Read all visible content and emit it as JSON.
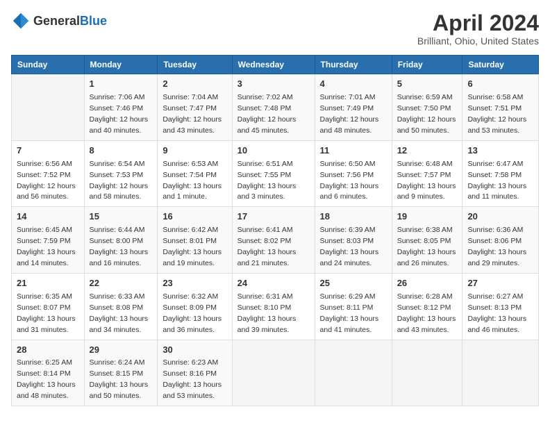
{
  "header": {
    "logo_general": "General",
    "logo_blue": "Blue",
    "title": "April 2024",
    "subtitle": "Brilliant, Ohio, United States"
  },
  "days_of_week": [
    "Sunday",
    "Monday",
    "Tuesday",
    "Wednesday",
    "Thursday",
    "Friday",
    "Saturday"
  ],
  "weeks": [
    [
      {
        "day": "",
        "sunrise": "",
        "sunset": "",
        "daylight": ""
      },
      {
        "day": "1",
        "sunrise": "Sunrise: 7:06 AM",
        "sunset": "Sunset: 7:46 PM",
        "daylight": "Daylight: 12 hours and 40 minutes."
      },
      {
        "day": "2",
        "sunrise": "Sunrise: 7:04 AM",
        "sunset": "Sunset: 7:47 PM",
        "daylight": "Daylight: 12 hours and 43 minutes."
      },
      {
        "day": "3",
        "sunrise": "Sunrise: 7:02 AM",
        "sunset": "Sunset: 7:48 PM",
        "daylight": "Daylight: 12 hours and 45 minutes."
      },
      {
        "day": "4",
        "sunrise": "Sunrise: 7:01 AM",
        "sunset": "Sunset: 7:49 PM",
        "daylight": "Daylight: 12 hours and 48 minutes."
      },
      {
        "day": "5",
        "sunrise": "Sunrise: 6:59 AM",
        "sunset": "Sunset: 7:50 PM",
        "daylight": "Daylight: 12 hours and 50 minutes."
      },
      {
        "day": "6",
        "sunrise": "Sunrise: 6:58 AM",
        "sunset": "Sunset: 7:51 PM",
        "daylight": "Daylight: 12 hours and 53 minutes."
      }
    ],
    [
      {
        "day": "7",
        "sunrise": "Sunrise: 6:56 AM",
        "sunset": "Sunset: 7:52 PM",
        "daylight": "Daylight: 12 hours and 56 minutes."
      },
      {
        "day": "8",
        "sunrise": "Sunrise: 6:54 AM",
        "sunset": "Sunset: 7:53 PM",
        "daylight": "Daylight: 12 hours and 58 minutes."
      },
      {
        "day": "9",
        "sunrise": "Sunrise: 6:53 AM",
        "sunset": "Sunset: 7:54 PM",
        "daylight": "Daylight: 13 hours and 1 minute."
      },
      {
        "day": "10",
        "sunrise": "Sunrise: 6:51 AM",
        "sunset": "Sunset: 7:55 PM",
        "daylight": "Daylight: 13 hours and 3 minutes."
      },
      {
        "day": "11",
        "sunrise": "Sunrise: 6:50 AM",
        "sunset": "Sunset: 7:56 PM",
        "daylight": "Daylight: 13 hours and 6 minutes."
      },
      {
        "day": "12",
        "sunrise": "Sunrise: 6:48 AM",
        "sunset": "Sunset: 7:57 PM",
        "daylight": "Daylight: 13 hours and 9 minutes."
      },
      {
        "day": "13",
        "sunrise": "Sunrise: 6:47 AM",
        "sunset": "Sunset: 7:58 PM",
        "daylight": "Daylight: 13 hours and 11 minutes."
      }
    ],
    [
      {
        "day": "14",
        "sunrise": "Sunrise: 6:45 AM",
        "sunset": "Sunset: 7:59 PM",
        "daylight": "Daylight: 13 hours and 14 minutes."
      },
      {
        "day": "15",
        "sunrise": "Sunrise: 6:44 AM",
        "sunset": "Sunset: 8:00 PM",
        "daylight": "Daylight: 13 hours and 16 minutes."
      },
      {
        "day": "16",
        "sunrise": "Sunrise: 6:42 AM",
        "sunset": "Sunset: 8:01 PM",
        "daylight": "Daylight: 13 hours and 19 minutes."
      },
      {
        "day": "17",
        "sunrise": "Sunrise: 6:41 AM",
        "sunset": "Sunset: 8:02 PM",
        "daylight": "Daylight: 13 hours and 21 minutes."
      },
      {
        "day": "18",
        "sunrise": "Sunrise: 6:39 AM",
        "sunset": "Sunset: 8:03 PM",
        "daylight": "Daylight: 13 hours and 24 minutes."
      },
      {
        "day": "19",
        "sunrise": "Sunrise: 6:38 AM",
        "sunset": "Sunset: 8:05 PM",
        "daylight": "Daylight: 13 hours and 26 minutes."
      },
      {
        "day": "20",
        "sunrise": "Sunrise: 6:36 AM",
        "sunset": "Sunset: 8:06 PM",
        "daylight": "Daylight: 13 hours and 29 minutes."
      }
    ],
    [
      {
        "day": "21",
        "sunrise": "Sunrise: 6:35 AM",
        "sunset": "Sunset: 8:07 PM",
        "daylight": "Daylight: 13 hours and 31 minutes."
      },
      {
        "day": "22",
        "sunrise": "Sunrise: 6:33 AM",
        "sunset": "Sunset: 8:08 PM",
        "daylight": "Daylight: 13 hours and 34 minutes."
      },
      {
        "day": "23",
        "sunrise": "Sunrise: 6:32 AM",
        "sunset": "Sunset: 8:09 PM",
        "daylight": "Daylight: 13 hours and 36 minutes."
      },
      {
        "day": "24",
        "sunrise": "Sunrise: 6:31 AM",
        "sunset": "Sunset: 8:10 PM",
        "daylight": "Daylight: 13 hours and 39 minutes."
      },
      {
        "day": "25",
        "sunrise": "Sunrise: 6:29 AM",
        "sunset": "Sunset: 8:11 PM",
        "daylight": "Daylight: 13 hours and 41 minutes."
      },
      {
        "day": "26",
        "sunrise": "Sunrise: 6:28 AM",
        "sunset": "Sunset: 8:12 PM",
        "daylight": "Daylight: 13 hours and 43 minutes."
      },
      {
        "day": "27",
        "sunrise": "Sunrise: 6:27 AM",
        "sunset": "Sunset: 8:13 PM",
        "daylight": "Daylight: 13 hours and 46 minutes."
      }
    ],
    [
      {
        "day": "28",
        "sunrise": "Sunrise: 6:25 AM",
        "sunset": "Sunset: 8:14 PM",
        "daylight": "Daylight: 13 hours and 48 minutes."
      },
      {
        "day": "29",
        "sunrise": "Sunrise: 6:24 AM",
        "sunset": "Sunset: 8:15 PM",
        "daylight": "Daylight: 13 hours and 50 minutes."
      },
      {
        "day": "30",
        "sunrise": "Sunrise: 6:23 AM",
        "sunset": "Sunset: 8:16 PM",
        "daylight": "Daylight: 13 hours and 53 minutes."
      },
      {
        "day": "",
        "sunrise": "",
        "sunset": "",
        "daylight": ""
      },
      {
        "day": "",
        "sunrise": "",
        "sunset": "",
        "daylight": ""
      },
      {
        "day": "",
        "sunrise": "",
        "sunset": "",
        "daylight": ""
      },
      {
        "day": "",
        "sunrise": "",
        "sunset": "",
        "daylight": ""
      }
    ]
  ]
}
